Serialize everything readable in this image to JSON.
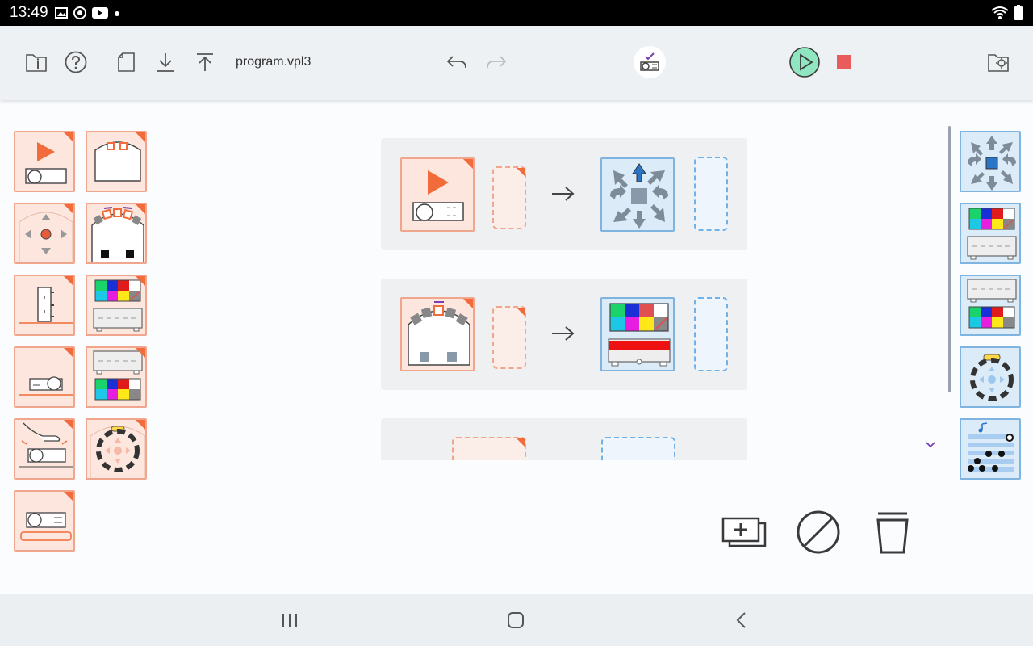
{
  "status_bar": {
    "time": "13:49"
  },
  "toolbar": {
    "filename": "program.vpl3"
  },
  "icons": {
    "file_info": "file-info-icon",
    "help": "help-icon",
    "new": "new-file-icon",
    "open": "download-icon",
    "save": "upload-icon",
    "undo": "undo-icon",
    "redo": "redo-icon",
    "robot": "robot-connection-icon",
    "run": "play-icon",
    "stop": "stop-icon",
    "settings": "settings-icon",
    "add_rule": "duplicate-icon",
    "disable": "disable-icon",
    "trash": "trash-icon"
  },
  "colors": {
    "event_fill": "#fde6dd",
    "event_border": "#f0a58c",
    "action_fill": "#dcebf8",
    "action_border": "#7fb4e0",
    "accent_orange": "#f26b3a",
    "run_green": "#8fe6c0",
    "stop_red": "#e85c5c"
  }
}
